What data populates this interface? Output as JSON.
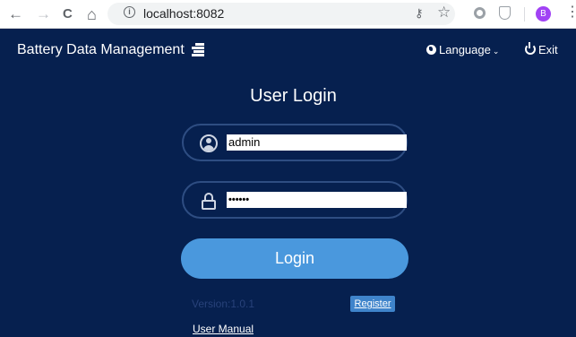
{
  "browser": {
    "back_icon": "←",
    "forward_icon": "→",
    "reload_icon": "C",
    "home_icon": "⌂",
    "url": "localhost:8082",
    "star_icon": "☆",
    "key_icon": "⚷",
    "profile_initial": "B",
    "menu_icon": "⋮",
    "profile_color": "#a142f4"
  },
  "header": {
    "title": "Battery Data Management",
    "language_label": "Language",
    "language_chevron": "⌄",
    "exit_label": "Exit"
  },
  "login": {
    "title": "User Login",
    "username_value": "admin",
    "password_value": "••••••",
    "login_button": "Login",
    "version": "Version:1.0.1",
    "register_button": "Register",
    "user_manual_link": "User Manual"
  },
  "colors": {
    "app_background": "#06204f",
    "login_button": "#4a98dd",
    "register_button": "#3f84cb",
    "field_border": "#2e4d82"
  }
}
